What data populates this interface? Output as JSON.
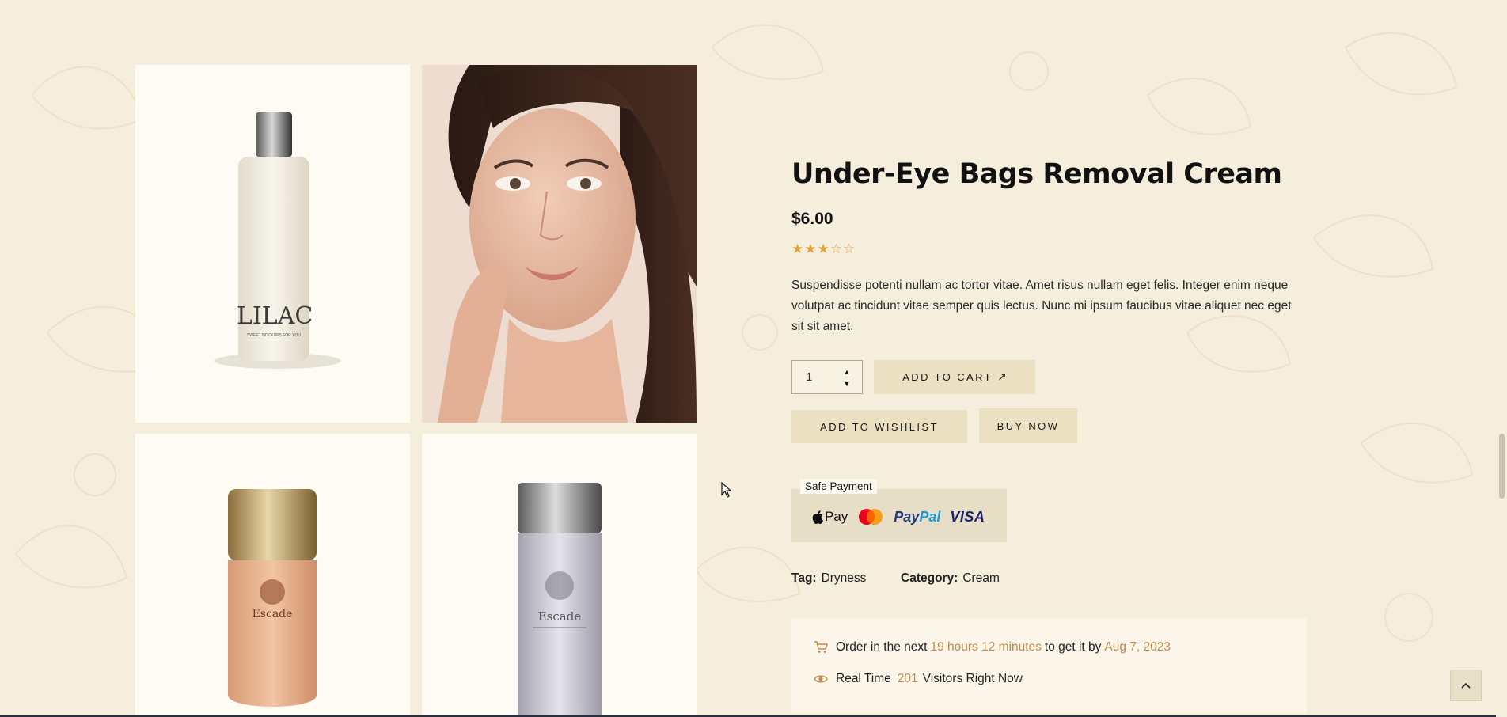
{
  "product": {
    "title": "Under-Eye Bags Removal Cream",
    "price": "$6.00",
    "rating": 3,
    "rating_max": 5,
    "description": "Suspendisse potenti nullam ac tortor vitae. Amet risus nullam eget felis. Integer enim neque volutpat ac tincidunt vitae semper quis lectus. Nunc mi ipsum faucibus vitae aliquet nec eget sit sit amet."
  },
  "gallery": {
    "bottle_1_brand": "LILAC",
    "bottle_1_sub": "SWEET NOCKUPS FOR YOU",
    "bottle_2_brand": "Escade",
    "bottle_3_brand": "Escade"
  },
  "cart": {
    "quantity": "1",
    "add_to_cart_label": "Add to cart",
    "wishlist_label": "Add to wishlist",
    "buy_now_label": "Buy now"
  },
  "payment": {
    "label": "Safe Payment",
    "methods": [
      "Apple Pay",
      "Mastercard",
      "PayPal",
      "VISA"
    ],
    "apple_text": "Pay",
    "paypal_a": "Pay",
    "paypal_b": "Pal",
    "visa_text": "VISA"
  },
  "meta": {
    "tag_key": "Tag:",
    "tag_value": "Dryness",
    "category_key": "Category:",
    "category_value": "Cream"
  },
  "delivery": {
    "prefix": "Order in the next",
    "time": "19 hours 12 minutes",
    "middle": "to get it by",
    "date": "Aug 7, 2023"
  },
  "visitors": {
    "prefix": "Real Time",
    "count": "201",
    "suffix": "Visitors Right Now"
  },
  "colors": {
    "background": "#f5eedc",
    "button": "#ece0c2",
    "star": "#e7a13a",
    "highlight": "#c08b4e"
  }
}
